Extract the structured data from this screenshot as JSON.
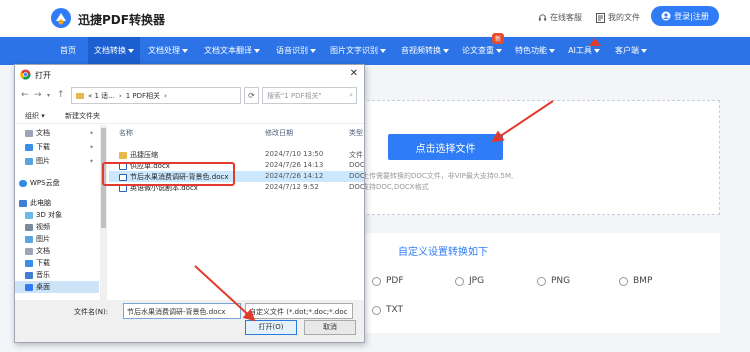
{
  "header": {
    "brand": "迅捷PDF转换器",
    "online_service": "在线客服",
    "my_files": "我的文件",
    "login": "登录|注册"
  },
  "nav": {
    "items": [
      {
        "label": "首页"
      },
      {
        "label": "文档转换"
      },
      {
        "label": "文档处理"
      },
      {
        "label": "文档文本翻译"
      },
      {
        "label": "语音识别"
      },
      {
        "label": "图片文字识别"
      },
      {
        "label": "音视频转换"
      },
      {
        "label": "论文查重"
      },
      {
        "label": "特色功能"
      },
      {
        "label": "AI工具"
      },
      {
        "label": "客户端"
      }
    ],
    "badge": "新"
  },
  "upload": {
    "button": "点击选择文件",
    "hint_line1": "上传需要转换的DOC文件，非VIP最大支持0.5M,",
    "hint_line2": "支持DOC,DOCX格式"
  },
  "settings": {
    "title": "自定义设置转换如下",
    "options": [
      "PDF",
      "JPG",
      "PNG",
      "BMP",
      "TXT"
    ]
  },
  "dialog": {
    "title": "打开",
    "breadcrumb": [
      "« 1 适...",
      "1 PDF相关"
    ],
    "search_placeholder": "搜索\"1 PDF相关\"",
    "toolbar": {
      "organize": "组织",
      "new_folder": "新建文件夹"
    },
    "sidebar": [
      {
        "label": "文档",
        "pinned": true
      },
      {
        "label": "下载",
        "pinned": true
      },
      {
        "label": "图片",
        "pinned": true
      },
      {
        "label": "WPS云盘",
        "pinned": false
      },
      {
        "label": "此电脑",
        "pinned": false
      },
      {
        "label": "3D 对象",
        "pinned": false
      },
      {
        "label": "视频",
        "pinned": false
      },
      {
        "label": "图片",
        "pinned": false
      },
      {
        "label": "文档",
        "pinned": false
      },
      {
        "label": "下载",
        "pinned": false
      },
      {
        "label": "音乐",
        "pinned": false
      },
      {
        "label": "桌面",
        "pinned": false
      }
    ],
    "columns": {
      "name": "名称",
      "modified": "修改日期",
      "type": "类型"
    },
    "files": [
      {
        "name": "迅捷压缩",
        "date": "2024/7/10 13:50",
        "type": "文件"
      },
      {
        "name": "供应单.docx",
        "date": "2024/7/26 14:13",
        "type": "DOC"
      },
      {
        "name": "节后水果消费调研-背景色.docx",
        "date": "2024/7/26 14:12",
        "type": "DOC"
      },
      {
        "name": "英语微小说剧本.docx",
        "date": "2024/7/12 9:52",
        "type": "DOC"
      }
    ],
    "filename_label": "文件名(N):",
    "filename_value": "节后水果消费调研-背景色.docx",
    "filetype_value": "自定义文件 (*.dot;*.doc;*.doc",
    "open_button": "打开(O)",
    "cancel_button": "取消"
  },
  "colors": {
    "brand_blue": "#2b73e6",
    "accent_red": "#e23b2e"
  }
}
